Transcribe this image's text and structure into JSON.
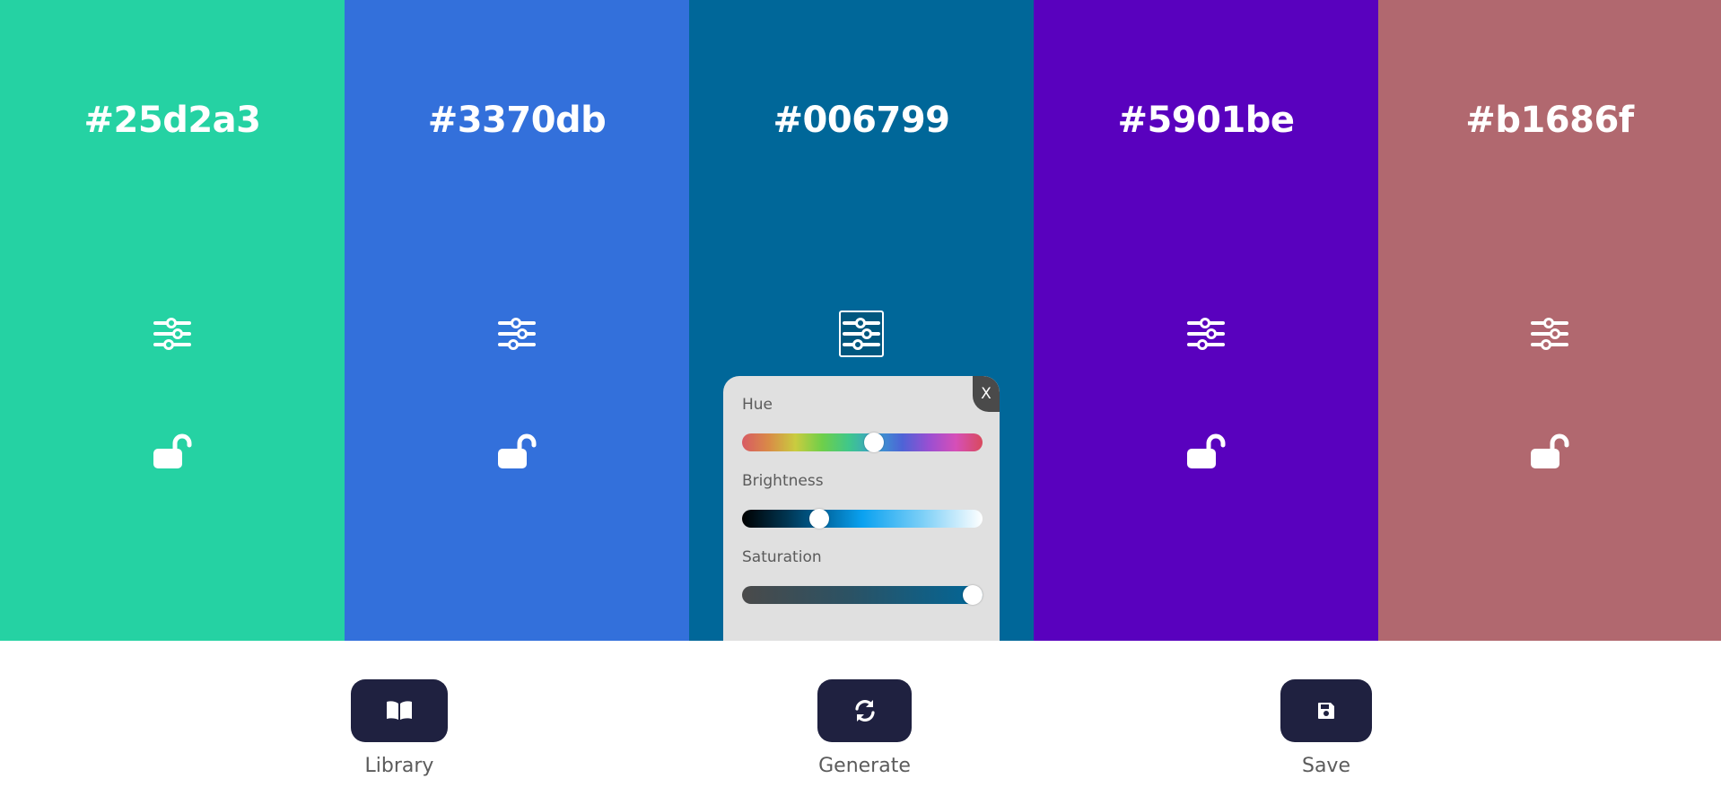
{
  "colors": [
    {
      "hex": "#25d2a3"
    },
    {
      "hex": "#3370db"
    },
    {
      "hex": "#006799"
    },
    {
      "hex": "#5901be"
    },
    {
      "hex": "#b1686f"
    }
  ],
  "panel": {
    "close_label": "X",
    "hue_label": "Hue",
    "hue_level": 0.55,
    "brightness_label": "Brightness",
    "brightness_level": 0.32,
    "saturation_label": "Saturation",
    "saturation_level": 0.96
  },
  "controls": {
    "library_label": "Library",
    "generate_label": "Generate",
    "save_label": "Save"
  },
  "icons": {
    "adjust": "sliders-icon",
    "lock": "unlock-icon",
    "library": "book-icon",
    "generate": "refresh-icon",
    "save": "floppy-disk-icon"
  },
  "theme": {
    "button_bg": "#1f2140",
    "panel_bg": "#e0e0e0",
    "label_color": "#5b5b5b"
  }
}
